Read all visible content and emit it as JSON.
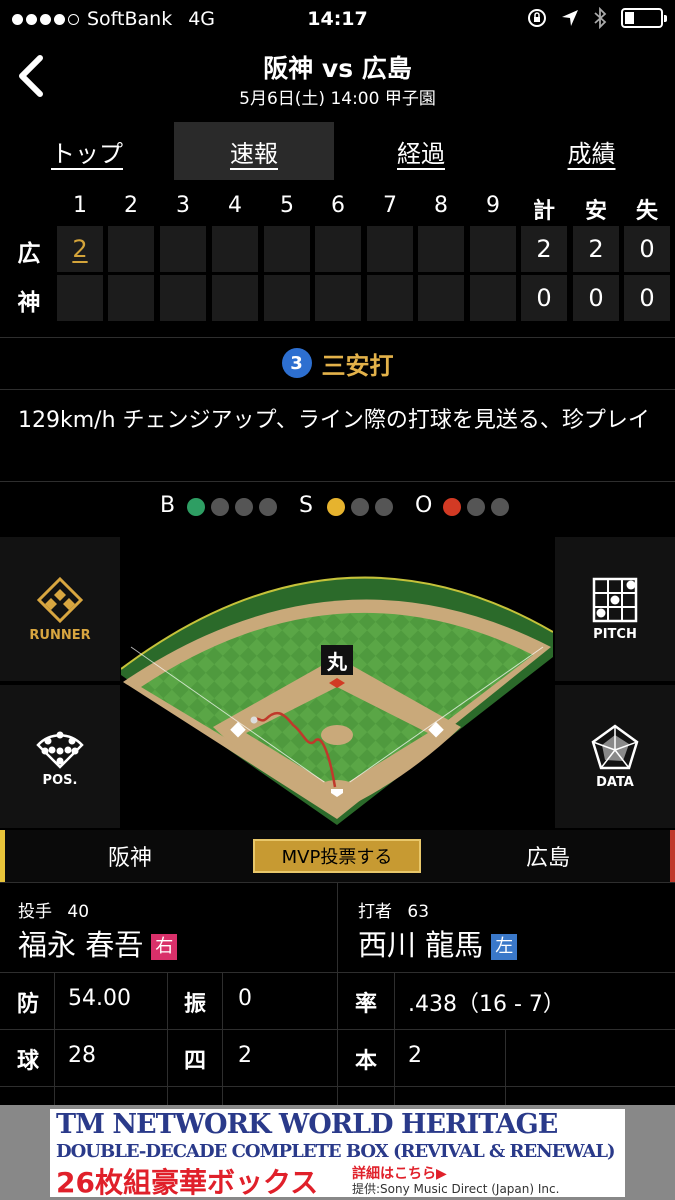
{
  "status_bar": {
    "carrier": "SoftBank",
    "network": "4G",
    "time": "14:17",
    "signal_dots": 5,
    "signal_filled": 4,
    "battery_level": 0.25
  },
  "header": {
    "title": "阪神 vs 広島",
    "subtitle": "5月6日(土) 14:00 甲子園"
  },
  "tabs": [
    {
      "label": "トップ",
      "active": false
    },
    {
      "label": "速報",
      "active": true
    },
    {
      "label": "経過",
      "active": false
    },
    {
      "label": "成績",
      "active": false
    }
  ],
  "scoreboard": {
    "innings": [
      "1",
      "2",
      "3",
      "4",
      "5",
      "6",
      "7",
      "8",
      "9"
    ],
    "totals_headers": [
      "計",
      "安",
      "失"
    ],
    "teams": [
      {
        "label": "広",
        "innings": [
          "2",
          "",
          "",
          "",
          "",
          "",
          "",
          "",
          ""
        ],
        "totals": [
          "2",
          "2",
          "0"
        ]
      },
      {
        "label": "神",
        "innings": [
          "",
          "",
          "",
          "",
          "",
          "",
          "",
          "",
          ""
        ],
        "totals": [
          "0",
          "0",
          "0"
        ]
      }
    ]
  },
  "play": {
    "number": "3",
    "result": "三安打",
    "description": "129km/h チェンジアップ、ライン際の打球を見送る、珍プレイ"
  },
  "count": {
    "balls_label": "B",
    "strikes_label": "S",
    "outs_label": "O",
    "balls": 1,
    "strikes": 1,
    "outs": 1,
    "colors": {
      "ball": "#2e9e63",
      "strike": "#e6b32e",
      "out": "#d23a24",
      "off": "#555555"
    }
  },
  "side_buttons": {
    "runner": "RUNNER",
    "pos": "POS.",
    "pitch": "PITCH",
    "data": "DATA"
  },
  "field": {
    "player_label": "丸"
  },
  "teams_bar": {
    "home": "阪神",
    "away": "広島",
    "mvp_label": "MVP投票する"
  },
  "pitcher": {
    "role": "投手",
    "number": "40",
    "name": "福永 春吾",
    "hand": "右",
    "stats": [
      {
        "key": "防",
        "value": "54.00"
      },
      {
        "key": "振",
        "value": "0"
      },
      {
        "key": "球",
        "value": "28"
      },
      {
        "key": "四",
        "value": "2"
      }
    ]
  },
  "batter": {
    "role": "打者",
    "number": "63",
    "name": "西川 龍馬",
    "hand": "左",
    "stats": [
      {
        "key": "率",
        "value": ".438（16 - 7）"
      },
      {
        "key": "本",
        "value": "2"
      }
    ]
  },
  "ad": {
    "line1": "TM NETWORK WORLD HERITAGE",
    "line2": "DOUBLE-DECADE COMPLETE BOX (REVIVAL & RENEWAL)",
    "line3": "26枚組豪華ボックス",
    "line4": "詳細はこちら▶",
    "line5": "提供:Sony Music Direct (Japan) Inc."
  }
}
